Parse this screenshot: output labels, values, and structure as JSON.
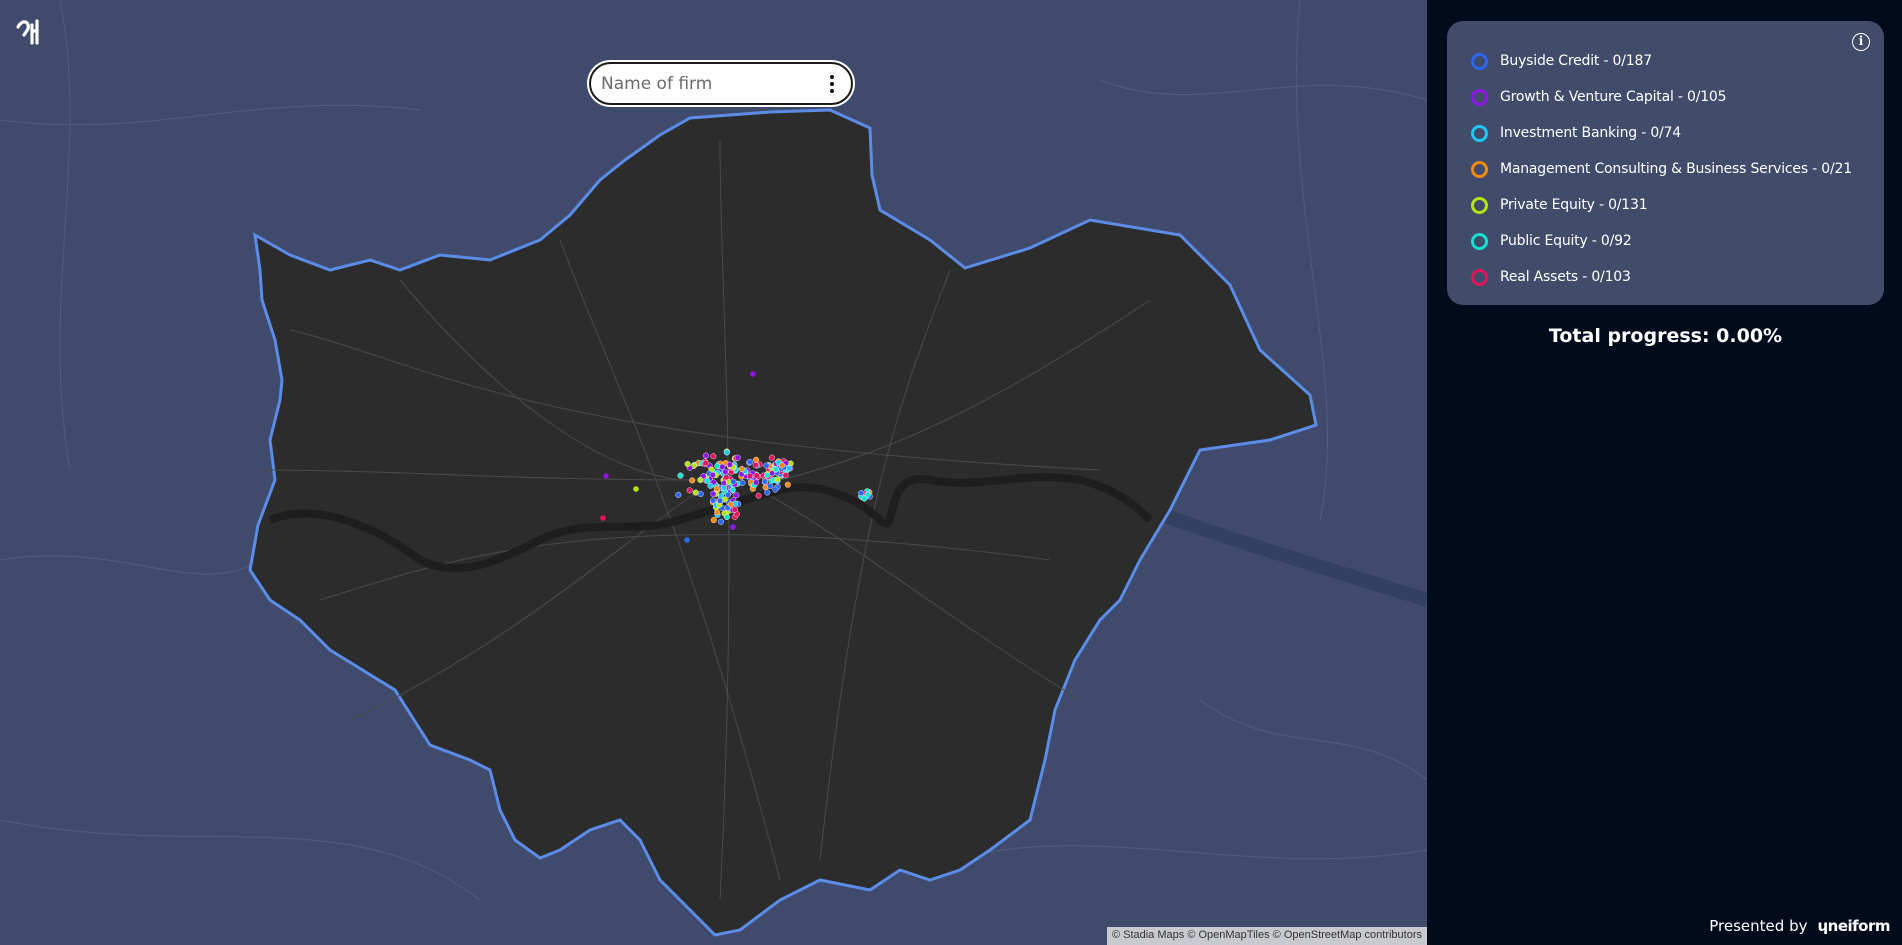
{
  "map": {
    "search": {
      "placeholder": "Name of firm"
    },
    "attribution": "© Stadia Maps © OpenMapTiles © OpenStreetMap contributors",
    "colors": {
      "land": "#3f4a6c",
      "region": "#2c2c2c",
      "boundary": "#5b8de8",
      "river": "#1e1e1e"
    }
  },
  "legend": {
    "items": [
      {
        "label": "Buyside Credit - 0/187",
        "color": "#2f67f5"
      },
      {
        "label": "Growth & Venture Capital - 0/105",
        "color": "#8f16e6"
      },
      {
        "label": "Investment Banking - 0/74",
        "color": "#1ec8f2"
      },
      {
        "label": "Management Consulting & Business Services - 0/21",
        "color": "#f28a16"
      },
      {
        "label": "Private Equity - 0/131",
        "color": "#b6e314"
      },
      {
        "label": "Public Equity - 0/92",
        "color": "#18e0d0"
      },
      {
        "label": "Real Assets - 0/103",
        "color": "#e0155c"
      }
    ]
  },
  "progress": {
    "text": "Total progress: 0.00%"
  },
  "footer": {
    "presented_by": "Presented by",
    "brand": "ɥneiform"
  }
}
